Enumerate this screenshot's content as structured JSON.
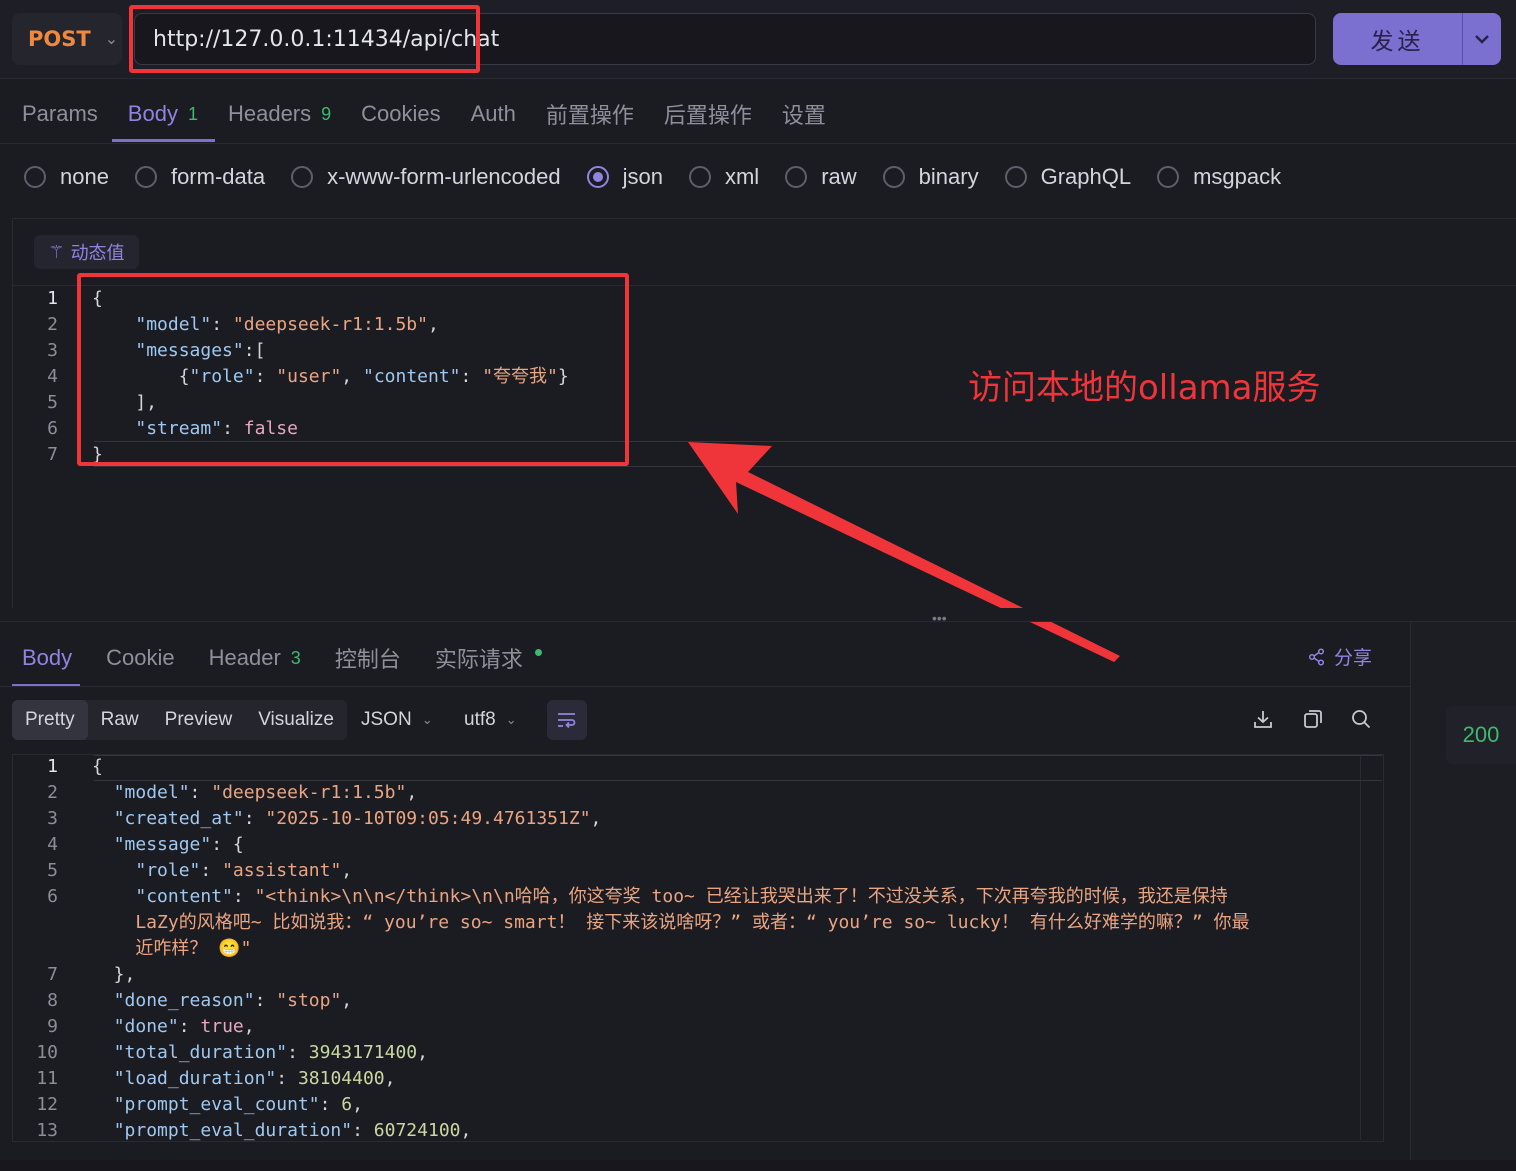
{
  "request": {
    "method": "POST",
    "url": "http://127.0.0.1:11434/api/chat",
    "send_label": "发送",
    "tabs": [
      {
        "label": "Params",
        "badge": ""
      },
      {
        "label": "Body",
        "badge": "1"
      },
      {
        "label": "Headers",
        "badge": "9"
      },
      {
        "label": "Cookies",
        "badge": ""
      },
      {
        "label": "Auth",
        "badge": ""
      },
      {
        "label": "前置操作",
        "badge": ""
      },
      {
        "label": "后置操作",
        "badge": ""
      },
      {
        "label": "设置",
        "badge": ""
      }
    ],
    "active_tab": "Body",
    "body_types": [
      "none",
      "form-data",
      "x-www-form-urlencoded",
      "json",
      "xml",
      "raw",
      "binary",
      "GraphQL",
      "msgpack"
    ],
    "selected_body_type": "json",
    "dynamic_value_label": "动态值",
    "body_lines": [
      "{",
      "    \"model\": \"deepseek-r1:1.5b\",",
      "    \"messages\":[",
      "        {\"role\": \"user\", \"content\": \"夸夸我\"}",
      "    ],",
      "    \"stream\": false",
      "}"
    ]
  },
  "annotation": "访问本地的ollama服务",
  "response": {
    "tabs": [
      {
        "label": "Body",
        "badge": ""
      },
      {
        "label": "Cookie",
        "badge": ""
      },
      {
        "label": "Header",
        "badge": "3"
      },
      {
        "label": "控制台",
        "badge": ""
      },
      {
        "label": "实际请求",
        "badge": ""
      }
    ],
    "active_tab": "Body",
    "share_label": "分享",
    "view_modes": [
      "Pretty",
      "Raw",
      "Preview",
      "Visualize"
    ],
    "selected_view": "Pretty",
    "format": "JSON",
    "encoding": "utf8",
    "status_code": "200",
    "body_lines": [
      {
        "num": "1",
        "text": "{"
      },
      {
        "num": "2",
        "text": "  \"model\": \"deepseek-r1:1.5b\","
      },
      {
        "num": "3",
        "text": "  \"created_at\": \"2025-10-10T09:05:49.4761351Z\","
      },
      {
        "num": "4",
        "text": "  \"message\": {"
      },
      {
        "num": "5",
        "text": "    \"role\": \"assistant\","
      },
      {
        "num": "6",
        "text": "    \"content\": \"<think>\\n\\n</think>\\n\\n哈哈，你这夸奖 too~ 已经让我哭出来了！不过没关系，下次再夸我的时候，我还是保持"
      },
      {
        "num": "",
        "text": "    LaZy的风格吧~ 比如说我：“ you’re so~ smart！ 接下来该说啥呀？” 或者：“ you’re so~ lucky！ 有什么好难学的嘛？” 你最"
      },
      {
        "num": "",
        "text": "    近咋样？ 😁\""
      },
      {
        "num": "7",
        "text": "  },"
      },
      {
        "num": "8",
        "text": "  \"done_reason\": \"stop\","
      },
      {
        "num": "9",
        "text": "  \"done\": true,"
      },
      {
        "num": "10",
        "text": "  \"total_duration\": 3943171400,"
      },
      {
        "num": "11",
        "text": "  \"load_duration\": 38104400,"
      },
      {
        "num": "12",
        "text": "  \"prompt_eval_count\": 6,"
      },
      {
        "num": "13",
        "text": "  \"prompt_eval_duration\": 60724100,"
      }
    ]
  },
  "colors": {
    "accent": "#7b6fd0",
    "method": "#f0883e",
    "success": "#3fb970",
    "annotation": "#f0353a"
  }
}
